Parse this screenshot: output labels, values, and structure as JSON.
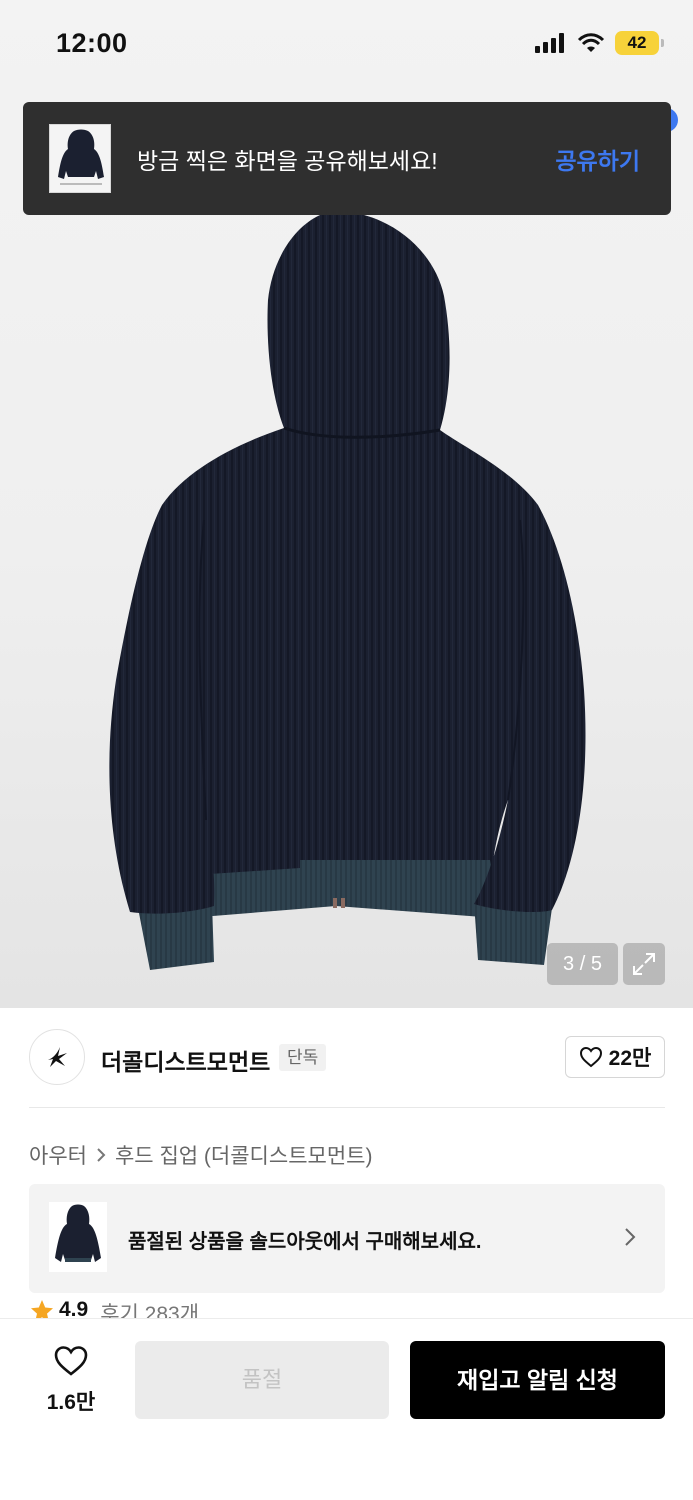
{
  "status_bar": {
    "time": "12:00",
    "battery": "42"
  },
  "toast": {
    "message": "방금 찍은 화면을 공유해보세요!",
    "action": "공유하기"
  },
  "gallery": {
    "counter": "3 / 5",
    "current_index": 3,
    "total": 5
  },
  "brand": {
    "name": "더콜디스트모먼트",
    "badge": "단독",
    "likes": "22만"
  },
  "breadcrumb": {
    "category": "아우터",
    "subcategory": "후드 집업 (더콜디스트모먼트)"
  },
  "soldout_banner": {
    "message": "품절된 상품을 솔드아웃에서 구매해보세요."
  },
  "rating": {
    "score": "4.9",
    "reviews": "후기 283개"
  },
  "bottom_bar": {
    "wish_count": "1.6만",
    "soldout_label": "품절",
    "restock_label": "재입고 알림 신청"
  },
  "colors": {
    "accent_blue": "#3d78f0",
    "star": "#f5a623",
    "hoodie": "#1a1f2e",
    "rib": "#2f4350"
  }
}
